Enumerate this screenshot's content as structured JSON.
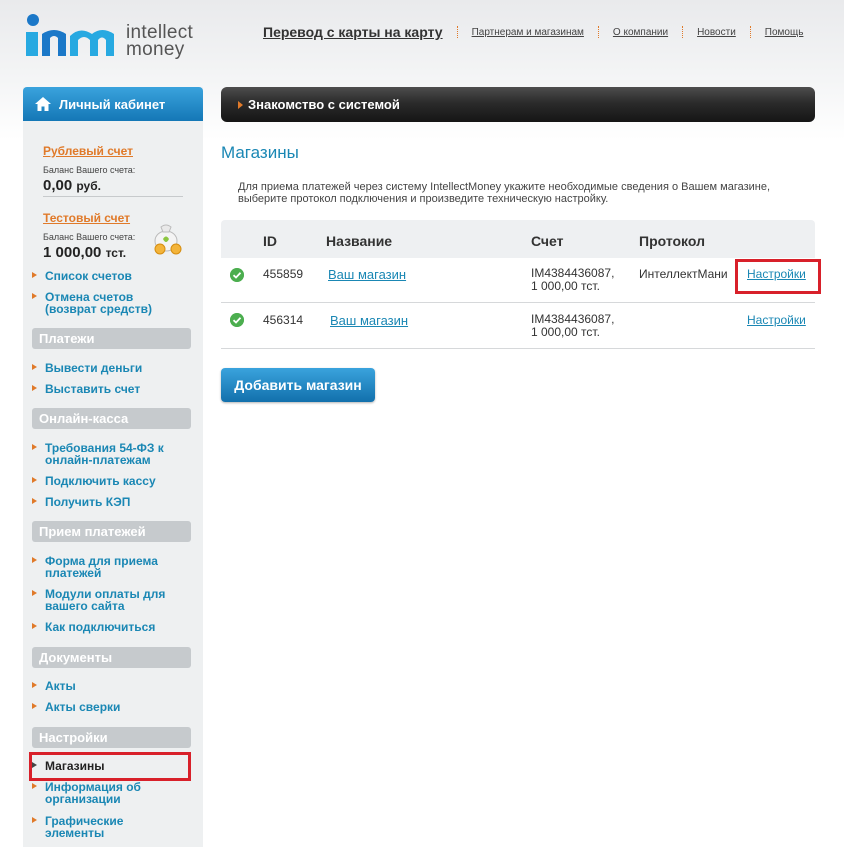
{
  "logo": {
    "line1": "intellect",
    "line2": "money"
  },
  "topnav": {
    "main": "Перевод с карты на карту",
    "links": [
      "Партнерам и магазинам",
      "О компании",
      "Новости",
      "Помощь"
    ]
  },
  "sidebar": {
    "header": "Личный кабинет",
    "rub": {
      "title": "Рублевый счет",
      "sub": "Баланс Вашего счета:",
      "value": "0,00",
      "currency": "руб."
    },
    "test": {
      "title": "Тестовый счет",
      "sub": "Баланс Вашего счета:",
      "value": "1 000,00",
      "currency": "тст."
    },
    "items_top": [
      "Список счетов",
      "Отмена счетов",
      "(возврат средств)"
    ],
    "sections": {
      "payments": {
        "title": "Платежи",
        "items": [
          "Вывести деньги",
          "Выставить счет"
        ]
      },
      "kassa": {
        "title": "Онлайн-касса",
        "items": [
          "Требования 54-ФЗ к",
          "онлайн-платежам",
          "Подключить кассу",
          "Получить КЭП"
        ]
      },
      "accept": {
        "title": "Прием платежей",
        "items": [
          "Форма для приема",
          "платежей",
          "Модули оплаты для",
          "вашего сайта",
          "Как подключиться"
        ]
      },
      "docs": {
        "title": "Документы",
        "items": [
          "Акты",
          "Акты сверки"
        ]
      },
      "settings": {
        "title": "Настройки",
        "items": [
          "Магазины",
          "Информация об",
          "организации",
          "Графические",
          "элементы"
        ]
      }
    }
  },
  "banner": "Знакомство с системой",
  "main": {
    "title": "Магазины",
    "intro_line1": "Для приема платежей через систему IntellectMoney укажите необходимые сведения о Вашем магазине,",
    "intro_line2": "выберите протокол подключения и произведите техническую настройку.",
    "columns": [
      "ID",
      "Название",
      "Счет",
      "Протокол"
    ],
    "rows": [
      {
        "id": "455859",
        "name": "Ваш магазин",
        "account1": "IM4384436087,",
        "account2": "1 000,00 тст.",
        "protocol": "ИнтеллектМани",
        "action": "Настройки"
      },
      {
        "id": "456314",
        "name": "Ваш магазин",
        "account1": "IM4384436087,",
        "account2": "1 000,00 тст.",
        "protocol": "",
        "action": "Настройки"
      }
    ],
    "add_button": "Добавить магазин"
  },
  "colors": {
    "accent": "#1a87b4",
    "orange": "#e07a2a",
    "highlight": "#d8202a",
    "ok": "#4cae4f"
  }
}
